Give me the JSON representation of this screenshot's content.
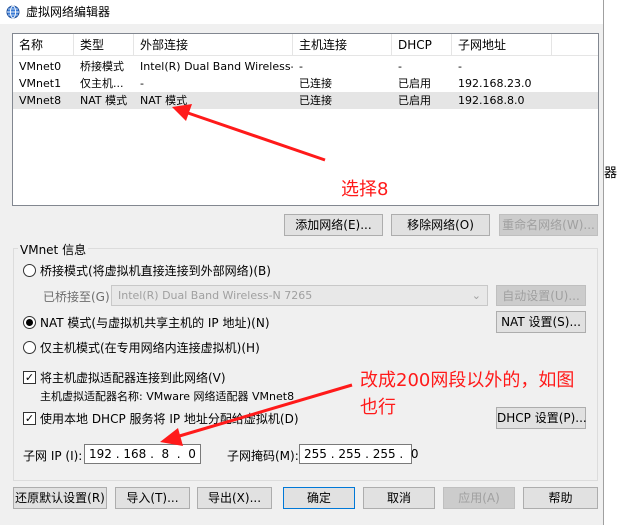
{
  "window": {
    "title": "虚拟网络编辑器",
    "right_partial_text": "器"
  },
  "network_list": {
    "columns": [
      "名称",
      "类型",
      "外部连接",
      "主机连接",
      "DHCP",
      "子网地址"
    ],
    "rows": [
      {
        "name": "VMnet0",
        "type": "桥接模式",
        "external": "Intel(R) Dual Band Wireless-...",
        "host": "-",
        "dhcp": "-",
        "subnet": "-"
      },
      {
        "name": "VMnet1",
        "type": "仅主机...",
        "external": "-",
        "host": "已连接",
        "dhcp": "已启用",
        "subnet": "192.168.23.0"
      },
      {
        "name": "VMnet8",
        "type": "NAT 模式",
        "external": "NAT 模式",
        "host": "已连接",
        "dhcp": "已启用",
        "subnet": "192.168.8.0"
      }
    ]
  },
  "list_buttons": {
    "add": "添加网络(E)...",
    "remove": "移除网络(O)",
    "rename": "重命名网络(W)..."
  },
  "vmnet_info": {
    "title": "VMnet 信息",
    "bridged_label": "桥接模式(将虚拟机直接连接到外部网络)(B)",
    "bridged_to_label": "已桥接至(G):",
    "bridged_to_value": "Intel(R) Dual Band Wireless-N 7265",
    "auto_settings": "自动设置(U)...",
    "nat_label": "NAT 模式(与虚拟机共享主机的 IP 地址)(N)",
    "nat_settings": "NAT 设置(S)...",
    "hostonly_label": "仅主机模式(在专用网络内连接虚拟机)(H)",
    "connect_adapter_label": "将主机虚拟适配器连接到此网络(V)",
    "adapter_name_label": "主机虚拟适配器名称: VMware 网络适配器 VMnet8",
    "dhcp_label": "使用本地 DHCP 服务将 IP 地址分配给虚拟机(D)",
    "dhcp_settings": "DHCP 设置(P)...",
    "subnet_ip_label": "子网 IP (I):",
    "subnet_ip_value": "192 . 168 .  8  .  0",
    "subnet_mask_label": "子网掩码(M):",
    "subnet_mask_value": "255 . 255 . 255 .  0"
  },
  "bottom_buttons": {
    "restore": "还原默认设置(R)",
    "import": "导入(T)...",
    "export": "导出(X)...",
    "ok": "确定",
    "cancel": "取消",
    "apply": "应用(A)",
    "help": "帮助"
  },
  "annotations": {
    "select_note": "选择8",
    "change_note_line1": "改成200网段以外的，如图",
    "change_note_line2": "也行",
    "color": "#ff1a1a"
  }
}
